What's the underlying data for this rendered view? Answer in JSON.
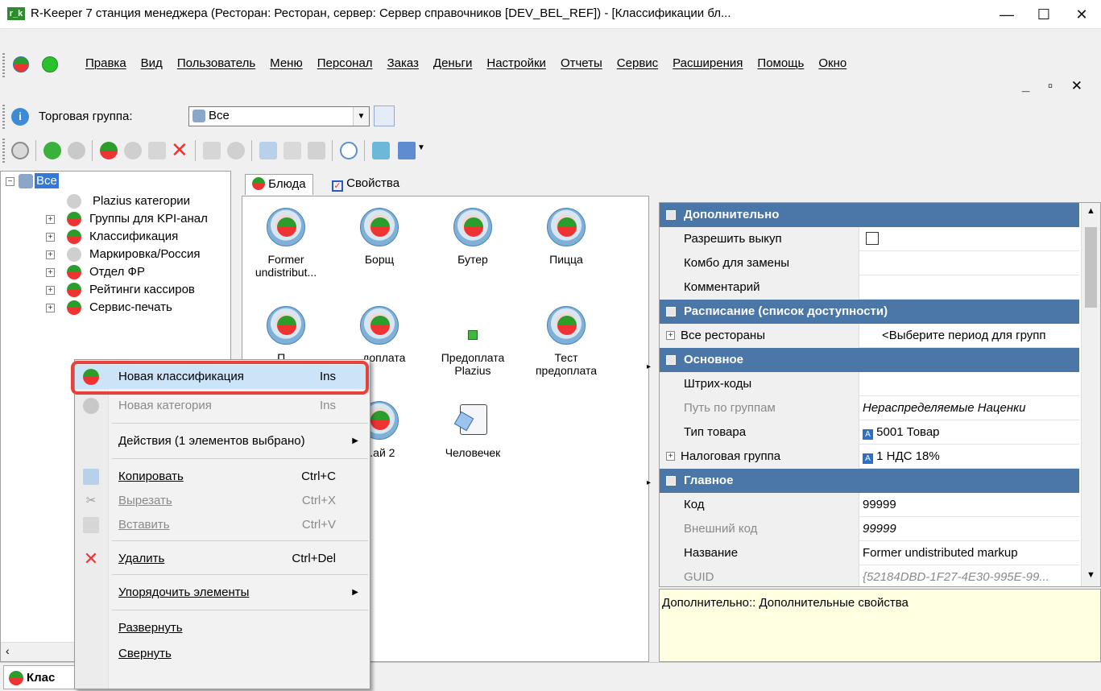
{
  "window": {
    "app_icon_text": "r_k",
    "title": "R-Keeper 7 станция менеджера (Ресторан: Ресторан, сервер: Сервер справочников [DEV_BEL_REF]) - [Классификации бл...",
    "minimize": "—",
    "maximize": "☐",
    "close": "✕"
  },
  "menubar": {
    "items": [
      "Правка",
      "Вид",
      "Пользователь",
      "Меню",
      "Персонал",
      "Заказ",
      "Деньги",
      "Настройки",
      "Отчеты",
      "Сервис",
      "Расширения",
      "Помощь",
      "Окно"
    ],
    "mdi_controls": "_ ▫ ✕"
  },
  "tradegroup": {
    "label": "Торговая группа:",
    "value": "Все"
  },
  "tree": {
    "root": "Все",
    "items": [
      "Plazius категории",
      "Группы для KPI-анал",
      "Классификация",
      "Маркировка/Россия",
      "Отдел ФР",
      "Рейтинги кассиров",
      "Сервис-печать"
    ]
  },
  "tabs": {
    "dishes": "Блюда",
    "properties": "Свойства"
  },
  "dishes": [
    {
      "name": "Former undistribut..."
    },
    {
      "name": "Борщ"
    },
    {
      "name": "Бутер"
    },
    {
      "name": "Пицца"
    },
    {
      "name": "П..."
    },
    {
      "name": "...доплата"
    },
    {
      "name": "Предоплата Plazius"
    },
    {
      "name": "Тест предоплата"
    },
    {
      "name": "...ай 2"
    },
    {
      "name": "Человечек"
    }
  ],
  "properties": {
    "sections": {
      "additional": "Дополнительно",
      "schedule": "Расписание (список доступности)",
      "basic": "Основное",
      "main": "Главное"
    },
    "rows": {
      "allow_buyout": "Разрешить выкуп",
      "combo": "Комбо для замены",
      "comment": "Комментарий",
      "all_restaurants": "Все рестораны",
      "all_restaurants_value": "<Выберите период для групп",
      "barcodes": "Штрих-коды",
      "group_path": "Путь по группам",
      "group_path_value": "Нераспределяемые Наценки",
      "item_type": "Тип товара",
      "item_type_value": "5001 Товар",
      "tax_group": "Налоговая группа",
      "tax_group_value": "1 НДС 18%",
      "code": "Код",
      "code_value": "99999",
      "ext_code": "Внешний код",
      "ext_code_value": "99999",
      "name": "Название",
      "name_value": "Former undistributed markup",
      "guid": "GUID",
      "guid_value": "{52184DBD-1F27-4E30-995E-99..."
    },
    "description": "Дополнительно:: Дополнительные свойства"
  },
  "context_menu": {
    "items": [
      {
        "label": "Новая классификация",
        "shortcut": "Ins",
        "enabled": true
      },
      {
        "label": "Новая категория",
        "shortcut": "Ins",
        "enabled": false
      },
      {
        "label": "Действия (1 элементов выбрано)",
        "shortcut": "",
        "enabled": true
      },
      {
        "label": "Копировать",
        "shortcut": "Ctrl+C",
        "enabled": true
      },
      {
        "label": "Вырезать",
        "shortcut": "Ctrl+X",
        "enabled": false
      },
      {
        "label": "Вставить",
        "shortcut": "Ctrl+V",
        "enabled": false
      },
      {
        "label": "Удалить",
        "shortcut": "Ctrl+Del",
        "enabled": true
      },
      {
        "label": "Упорядочить элементы",
        "shortcut": "",
        "enabled": true
      },
      {
        "label": "Развернуть",
        "shortcut": "",
        "enabled": true
      },
      {
        "label": "Свернуть",
        "shortcut": "",
        "enabled": true
      }
    ]
  },
  "statusbar": {
    "tab": "Клас"
  },
  "colors": {
    "section_header": "#4a76a8",
    "highlight_border": "#e8403a",
    "menu_selected": "#cce4f7",
    "description_bg": "#ffffe1"
  }
}
